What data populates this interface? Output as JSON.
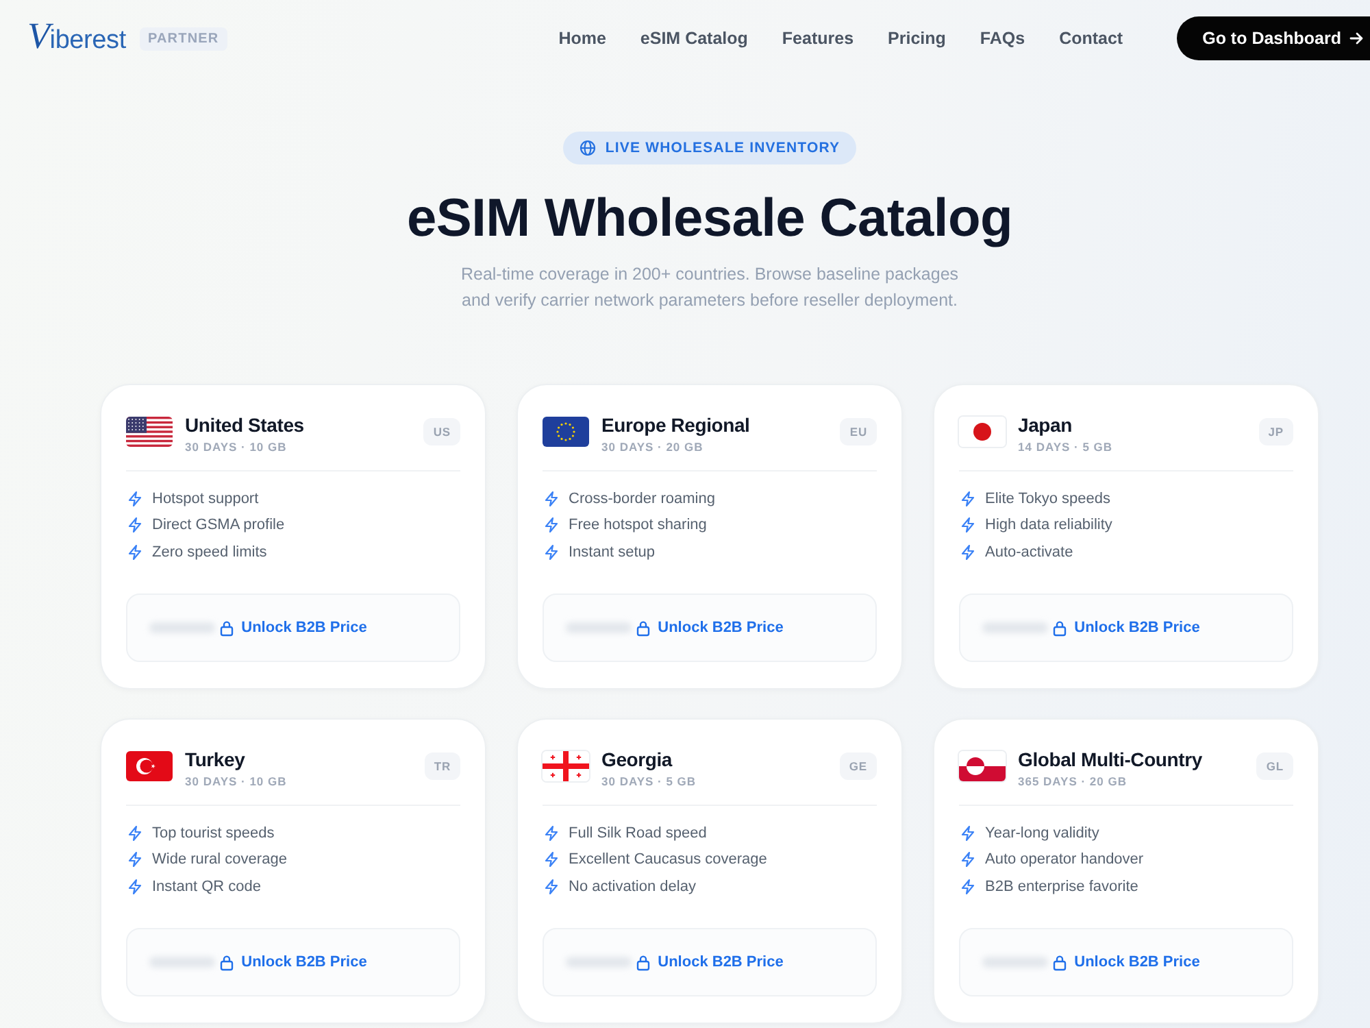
{
  "header": {
    "logo": "Viberest",
    "badge": "PARTNER",
    "nav": [
      "Home",
      "eSIM Catalog",
      "Features",
      "Pricing",
      "FAQs",
      "Contact"
    ],
    "cta": "Go to Dashboard"
  },
  "hero": {
    "pill": "LIVE WHOLESALE INVENTORY",
    "title": "eSIM Wholesale Catalog",
    "subtitle": "Real-time coverage in 200+ countries. Browse baseline packages and verify carrier network parameters before reseller deployment."
  },
  "plans": [
    {
      "kind": "stripes",
      "name": "United States",
      "meta": "30 DAYS · 10 GB",
      "code": "US",
      "features": [
        "Hotspot support",
        "Direct GSMA profile",
        "Zero speed limits"
      ],
      "action": "Unlock B2B Price"
    },
    {
      "kind": "stars",
      "name": "Europe Regional",
      "meta": "30 DAYS · 20 GB",
      "code": "EU",
      "features": [
        "Cross-border roaming",
        "Free hotspot sharing",
        "Instant setup"
      ],
      "action": "Unlock B2B Price"
    },
    {
      "kind": "disc",
      "name": "Japan",
      "meta": "14 DAYS · 5 GB",
      "code": "JP",
      "features": [
        "Elite Tokyo speeds",
        "High data reliability",
        "Auto-activate"
      ],
      "action": "Unlock B2B Price"
    },
    {
      "kind": "crescent",
      "name": "Turkey",
      "meta": "30 DAYS · 10 GB",
      "code": "TR",
      "features": [
        "Top tourist speeds",
        "Wide rural coverage",
        "Instant QR code"
      ],
      "action": "Unlock B2B Price"
    },
    {
      "kind": "crosses",
      "name": "Georgia",
      "meta": "30 DAYS · 5 GB",
      "code": "GE",
      "features": [
        "Full Silk Road speed",
        "Excellent Caucasus coverage",
        "No activation delay"
      ],
      "action": "Unlock B2B Price"
    },
    {
      "kind": "halves",
      "name": "Global Multi-Country",
      "meta": "365 DAYS · 20 GB",
      "code": "GL",
      "features": [
        "Year-long validity",
        "Auto operator handover",
        "B2B enterprise favorite"
      ],
      "action": "Unlock B2B Price"
    }
  ]
}
